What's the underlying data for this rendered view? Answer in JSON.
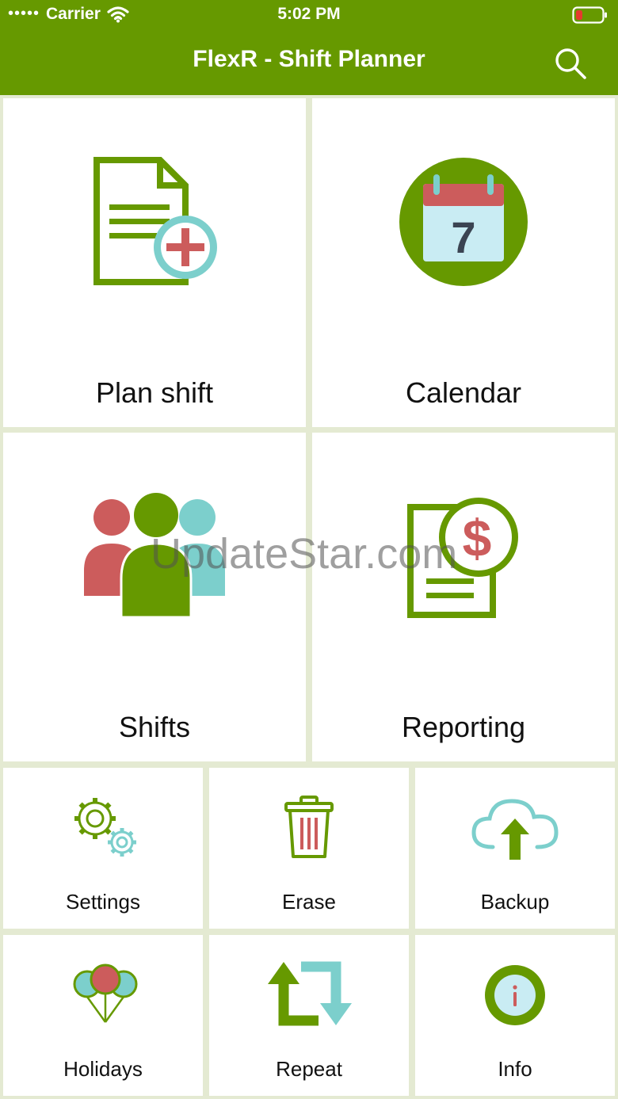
{
  "status_bar": {
    "signal_dots": "•••••",
    "carrier": "Carrier",
    "time": "5:02 PM"
  },
  "header": {
    "title": "FlexR - Shift Planner",
    "search_icon": "search-icon"
  },
  "big_tiles": [
    {
      "label": "Plan shift",
      "icon": "document-add-icon"
    },
    {
      "label": "Calendar",
      "icon": "calendar-icon"
    },
    {
      "label": "Shifts",
      "icon": "people-icon"
    },
    {
      "label": "Reporting",
      "icon": "report-dollar-icon"
    }
  ],
  "small_tiles": [
    {
      "label": "Settings",
      "icon": "gears-icon"
    },
    {
      "label": "Erase",
      "icon": "trash-icon"
    },
    {
      "label": "Backup",
      "icon": "cloud-upload-icon"
    },
    {
      "label": "Holidays",
      "icon": "balloons-icon"
    },
    {
      "label": "Repeat",
      "icon": "repeat-icon"
    },
    {
      "label": "Info",
      "icon": "info-icon"
    }
  ],
  "calendar_day": "7",
  "watermark": "UpdateStar.com",
  "colors": {
    "brand_green": "#669900",
    "background": "#e4ead2",
    "red": "#cc5c5c",
    "teal": "#7ccfcc",
    "light_blue": "#c9ecf3"
  }
}
